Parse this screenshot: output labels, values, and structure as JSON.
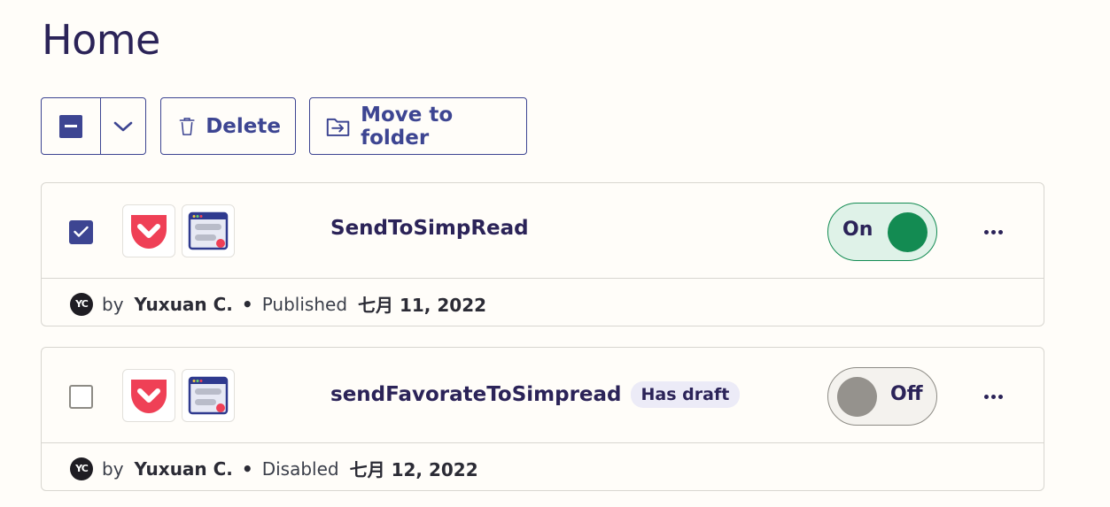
{
  "page": {
    "title": "Home"
  },
  "toolbar": {
    "delete_label": "Delete",
    "move_label": "Move to folder"
  },
  "zaps": [
    {
      "name": "SendToSimpRead",
      "selected": true,
      "badge": "",
      "status_toggle": "On",
      "apps": [
        "pocket-icon",
        "simpread-icon"
      ],
      "avatar_initials": "YC",
      "by": "by",
      "author": "Yuxuan C.",
      "separator": "•",
      "status_text": "Published",
      "date": "七月 11, 2022"
    },
    {
      "name": "sendFavorateToSimpread",
      "selected": false,
      "badge": "Has draft",
      "status_toggle": "Off",
      "apps": [
        "pocket-icon",
        "simpread-icon"
      ],
      "avatar_initials": "YC",
      "by": "by",
      "author": "Yuxuan C.",
      "separator": "•",
      "status_text": "Disabled",
      "date": "七月 12, 2022"
    }
  ],
  "colors": {
    "accent": "#3d4592",
    "on_green": "#138b52",
    "pocket_red": "#ef4056",
    "background": "#fffdf9"
  }
}
